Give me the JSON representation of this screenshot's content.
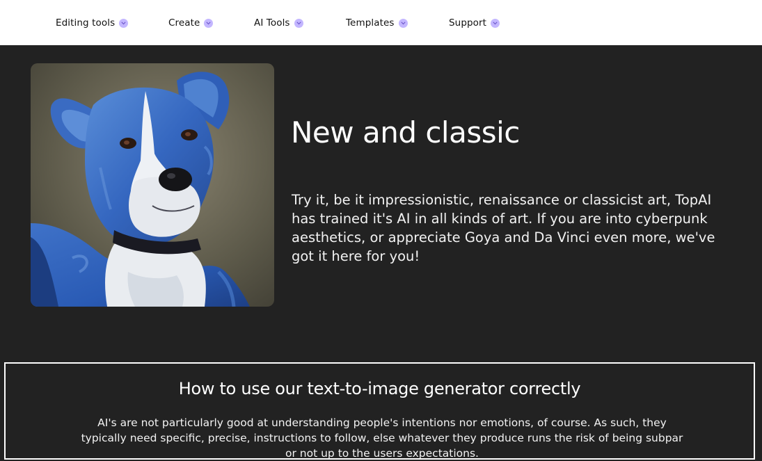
{
  "nav": {
    "items": [
      {
        "label": "Editing tools"
      },
      {
        "label": "Create"
      },
      {
        "label": "AI Tools"
      },
      {
        "label": "Templates"
      },
      {
        "label": "Support"
      }
    ],
    "chevron_icon": "chevron-down-icon",
    "chevron_color": "#c3b6ff"
  },
  "hero": {
    "image_icon": "blue-dog-painting",
    "title": "New and classic",
    "text": "Try it, be it impressionistic, renaissance or classicist art, TopAI has trained it's AI in all kinds of art. If you are into cyberpunk aesthetics, or appreciate Goya and Da Vinci even more, we've got it here for you!"
  },
  "howto": {
    "title": "How to use our text-to-image generator correctly",
    "text": "AI's are not particularly good at understanding people's intentions nor emotions, of course. As such, they typically need specific, precise, instructions to follow, else whatever they produce runs the risk of being subpar or not up to the users expectations."
  },
  "colors": {
    "background": "#222222",
    "nav_background": "#ffffff",
    "accent": "#c3b6ff"
  }
}
